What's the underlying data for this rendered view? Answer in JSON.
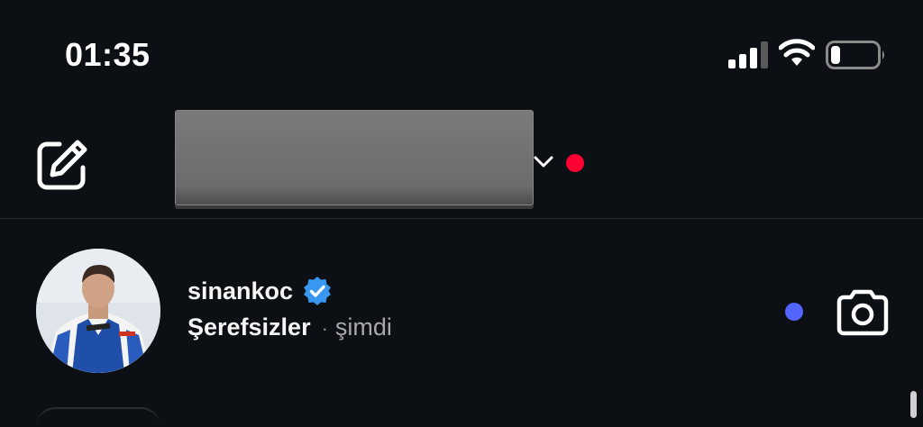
{
  "status_bar": {
    "time": "01:35",
    "signal_icon": "cellular-signal-icon",
    "wifi_icon": "wifi-icon",
    "battery_icon": "battery-icon",
    "battery_level": 0.2
  },
  "header": {
    "compose_icon": "new-message-icon",
    "account_name_redacted": true,
    "chevron_icon": "chevron-down-icon",
    "notification_dot_color": "#ff0033"
  },
  "thread": {
    "username": "sinankoc",
    "verified_icon": "verified-badge-icon",
    "verified_color": "#3897f0",
    "message": "Şerefsizler",
    "separator": "·",
    "timestamp": "şimdi",
    "unread_dot_color": "#5265ff",
    "camera_icon": "camera-icon"
  }
}
